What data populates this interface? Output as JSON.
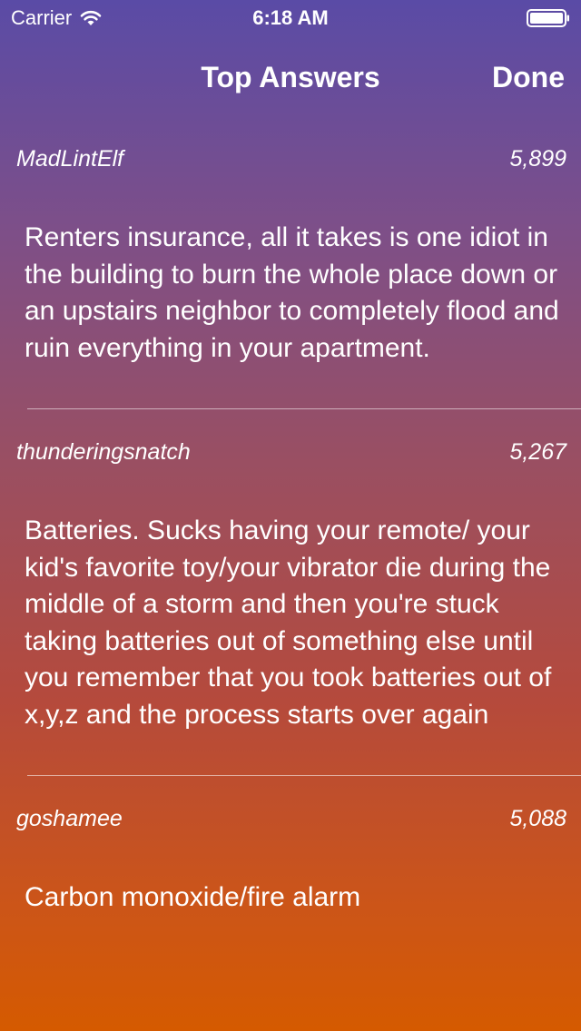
{
  "status_bar": {
    "carrier": "Carrier",
    "time": "6:18 AM"
  },
  "nav": {
    "title": "Top Answers",
    "done_label": "Done"
  },
  "answers": [
    {
      "author": "MadLintElf",
      "score": "5,899",
      "text": "Renters insurance, all it takes is one idiot in the building to burn the whole place down or an upstairs neighbor to completely flood and ruin everything in your apartment."
    },
    {
      "author": "thunderingsnatch",
      "score": "5,267",
      "text": "Batteries. Sucks having your remote/ your kid's favorite toy/your vibrator die during the middle of a storm and then you're stuck taking batteries out of something else until you remember that you took batteries out of x,y,z and the process starts over again"
    },
    {
      "author": "goshamee",
      "score": "5,088",
      "text": "Carbon monoxide/fire alarm"
    }
  ]
}
